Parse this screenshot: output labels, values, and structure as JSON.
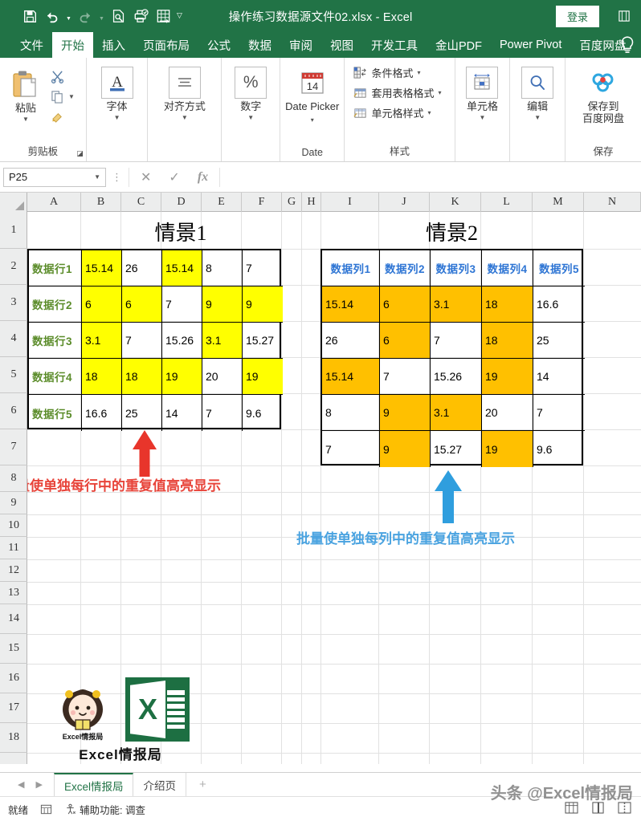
{
  "window": {
    "title": "操作练习数据源文件02.xlsx  -  Excel",
    "signin_label": "登录",
    "qat": [
      {
        "name": "save-icon",
        "label": "保存"
      },
      {
        "name": "undo-icon",
        "label": "撤消"
      },
      {
        "name": "redo-icon",
        "label": "恢复"
      },
      {
        "name": "print-preview-icon",
        "label": "打印预览和打印"
      },
      {
        "name": "quick-print-icon",
        "label": "快速打印"
      },
      {
        "name": "autofit-icon",
        "label": "自动调整"
      },
      {
        "name": "customize-qat-caret",
        "label": "自定义快速访问工具栏"
      }
    ],
    "restore_icon": "restore-window-icon"
  },
  "ribbon": {
    "tabs": [
      {
        "label": "文件",
        "active": false
      },
      {
        "label": "开始",
        "active": true
      },
      {
        "label": "插入",
        "active": false
      },
      {
        "label": "页面布局",
        "active": false
      },
      {
        "label": "公式",
        "active": false
      },
      {
        "label": "数据",
        "active": false
      },
      {
        "label": "审阅",
        "active": false
      },
      {
        "label": "视图",
        "active": false
      },
      {
        "label": "开发工具",
        "active": false
      },
      {
        "label": "金山PDF",
        "active": false
      },
      {
        "label": "Power Pivot",
        "active": false
      },
      {
        "label": "百度网盘",
        "active": false
      }
    ],
    "help_icon": "lightbulb-icon",
    "groups": {
      "clipboard": {
        "name": "剪贴板",
        "paste_label": "粘贴",
        "cut_label": "剪切",
        "copy_label": "复制",
        "format_painter_label": "格式刷",
        "launcher": "dialog-launcher"
      },
      "font": {
        "name": "",
        "label": "字体"
      },
      "alignment": {
        "name": "",
        "label": "对齐方式"
      },
      "number": {
        "name": "",
        "label": "数字",
        "symbol": "%"
      },
      "date": {
        "name": "Date",
        "label": "Date Picker",
        "day": "14"
      },
      "styles": {
        "name": "样式",
        "items": [
          "条件格式",
          "套用表格格式",
          "单元格样式"
        ]
      },
      "cells": {
        "label": "单元格"
      },
      "editing": {
        "label": "编辑"
      },
      "save": {
        "name": "保存",
        "label": "保存到\n百度网盘",
        "line1": "保存到",
        "line2": "百度网盘"
      }
    }
  },
  "formula_bar": {
    "name_box_value": "P25",
    "cancel_icon": "cancel-icon",
    "confirm_icon": "confirm-icon",
    "fx_label": "fx",
    "input_value": ""
  },
  "grid": {
    "columns": [
      "A",
      "B",
      "C",
      "D",
      "E",
      "F",
      "G",
      "H",
      "I",
      "J",
      "K",
      "L",
      "M",
      "N"
    ],
    "rows": [
      "1",
      "2",
      "3",
      "4",
      "5",
      "6",
      "7",
      "8",
      "9",
      "10",
      "11",
      "12",
      "13",
      "14",
      "15",
      "16",
      "17",
      "18"
    ]
  },
  "scene1": {
    "title": "情景1",
    "row_labels": [
      "数据行1",
      "数据行2",
      "数据行3",
      "数据行4",
      "数据行5"
    ],
    "rows": [
      [
        {
          "v": "15.14",
          "hl": true
        },
        {
          "v": "26",
          "hl": false
        },
        {
          "v": "15.14",
          "hl": true
        },
        {
          "v": "8",
          "hl": false
        },
        {
          "v": "7",
          "hl": false
        }
      ],
      [
        {
          "v": "6",
          "hl": true
        },
        {
          "v": "6",
          "hl": true
        },
        {
          "v": "7",
          "hl": false
        },
        {
          "v": "9",
          "hl": true
        },
        {
          "v": "9",
          "hl": true
        }
      ],
      [
        {
          "v": "3.1",
          "hl": true
        },
        {
          "v": "7",
          "hl": false
        },
        {
          "v": "15.26",
          "hl": false
        },
        {
          "v": "3.1",
          "hl": true
        },
        {
          "v": "15.27",
          "hl": false
        }
      ],
      [
        {
          "v": "18",
          "hl": true
        },
        {
          "v": "18",
          "hl": true
        },
        {
          "v": "19",
          "hl": true
        },
        {
          "v": "20",
          "hl": false
        },
        {
          "v": "19",
          "hl": true
        }
      ],
      [
        {
          "v": "16.6",
          "hl": false
        },
        {
          "v": "25",
          "hl": false
        },
        {
          "v": "14",
          "hl": false
        },
        {
          "v": "7",
          "hl": false
        },
        {
          "v": "9.6",
          "hl": false
        }
      ]
    ],
    "highlight_color": "#ffff00",
    "note": "批量使单独每行中的重复值高亮显示",
    "note_color": "#e8443a",
    "arrow_color": "#e8352b"
  },
  "scene2": {
    "title": "情景2",
    "col_labels": [
      "数据列1",
      "数据列2",
      "数据列3",
      "数据列4",
      "数据列5"
    ],
    "rows": [
      [
        {
          "v": "15.14",
          "hl": true
        },
        {
          "v": "6",
          "hl": true
        },
        {
          "v": "3.1",
          "hl": true
        },
        {
          "v": "18",
          "hl": true
        },
        {
          "v": "16.6",
          "hl": false
        }
      ],
      [
        {
          "v": "26",
          "hl": false
        },
        {
          "v": "6",
          "hl": true
        },
        {
          "v": "7",
          "hl": false
        },
        {
          "v": "18",
          "hl": true
        },
        {
          "v": "25",
          "hl": false
        }
      ],
      [
        {
          "v": "15.14",
          "hl": true
        },
        {
          "v": "7",
          "hl": false
        },
        {
          "v": "15.26",
          "hl": false
        },
        {
          "v": "19",
          "hl": true
        },
        {
          "v": "14",
          "hl": false
        }
      ],
      [
        {
          "v": "8",
          "hl": false
        },
        {
          "v": "9",
          "hl": true
        },
        {
          "v": "3.1",
          "hl": true
        },
        {
          "v": "20",
          "hl": false
        },
        {
          "v": "7",
          "hl": false
        }
      ],
      [
        {
          "v": "7",
          "hl": false
        },
        {
          "v": "9",
          "hl": true
        },
        {
          "v": "15.27",
          "hl": false
        },
        {
          "v": "19",
          "hl": true
        },
        {
          "v": "9.6",
          "hl": false
        }
      ]
    ],
    "highlight_color": "#ffc000",
    "note": "批量使单独每列中的重复值高亮显示",
    "note_color": "#4aa3e0",
    "arrow_color": "#2f9ede"
  },
  "logos": {
    "mascot_caption": "Excel情报局",
    "excel_letter": "X",
    "brand_text": "Excel情报局"
  },
  "sheet_tabs": {
    "tabs": [
      {
        "label": "Excel情报局",
        "active": true
      },
      {
        "label": "介绍页",
        "active": false
      }
    ],
    "add_label": "+"
  },
  "status_bar": {
    "ready": "就绪",
    "accessibility": "辅助功能: 调查",
    "watermark": "头条 @Excel情报局"
  }
}
